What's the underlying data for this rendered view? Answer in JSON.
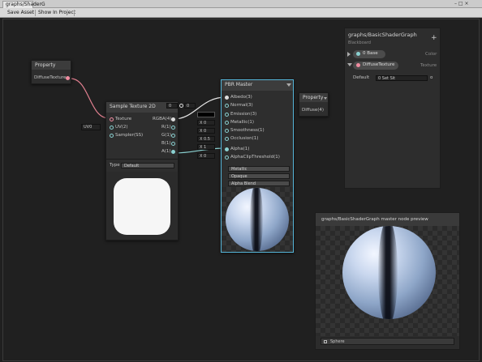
{
  "window": {
    "tab_label": "graphs/ShaderG",
    "controls": "–  □  ×"
  },
  "toolbar": {
    "save_asset": "Save Asset",
    "show_in_project": "Show In Project"
  },
  "property_node": {
    "title": "Property",
    "output": "DiffuseTexture"
  },
  "sample_node": {
    "title": "Sample Texture 2D",
    "lod_value": "0",
    "uv_value": "0",
    "uv_field": "UV0",
    "inputs": [
      "Texture",
      "UV(2)",
      "Sampler(SS)"
    ],
    "outputs": [
      "RGBA(4)",
      "R(1)",
      "G(1)",
      "B(1)",
      "A(1)"
    ],
    "type_label": "Type",
    "type_value": "Default"
  },
  "pbr_node": {
    "title": "PBR Master",
    "inputs": [
      "Albedo(3)",
      "Normal(3)",
      "Emission(3)",
      "Metallic(1)",
      "Smoothness(1)",
      "Occlusion(1)",
      "Alpha(1)",
      "AlphaClipThreshold(1)"
    ],
    "fields": [
      "X 0",
      "X 0",
      "X 0.5",
      "X 1",
      "X 0"
    ],
    "workflow": "Metallic",
    "surface": "Opaque",
    "blend": "Alpha Blend"
  },
  "property2_node": {
    "title": "Property",
    "output": "Diffuse(4)"
  },
  "blackboard": {
    "title": "graphs/BasicShaderGraph",
    "subtitle": "Blackboard",
    "add": "+",
    "properties": [
      {
        "name": "0 Base",
        "type": "Color"
      },
      {
        "name": "DiffuseTexture",
        "type": "Texture"
      }
    ],
    "default_label": "Default",
    "default_value": "0 Set Sit",
    "dot_icon": "o"
  },
  "preview": {
    "title": "graphs/BasicShaderGraph master node preview",
    "footer": "Sphere"
  }
}
